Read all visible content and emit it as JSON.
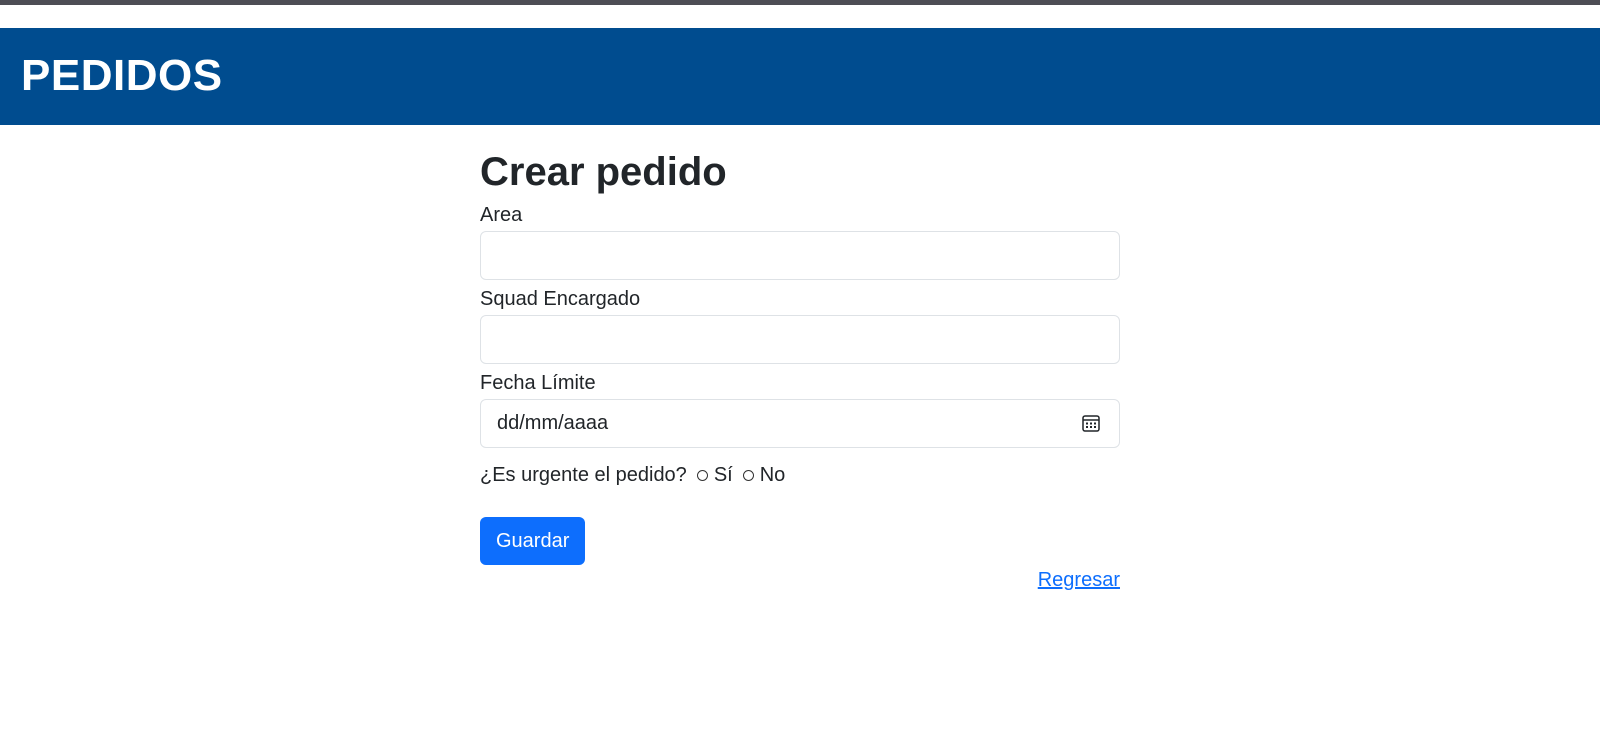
{
  "header": {
    "title": "PEDIDOS",
    "background_color": "#004c8f"
  },
  "form": {
    "title": "Crear pedido",
    "fields": {
      "area": {
        "label": "Area",
        "value": ""
      },
      "squad": {
        "label": "Squad Encargado",
        "value": ""
      },
      "deadline": {
        "label": "Fecha Límite",
        "value": "dd/mm/aaaa",
        "icon": "calendar-icon"
      }
    },
    "urgent": {
      "question": "¿Es urgente el pedido?",
      "options": [
        "Sí",
        "No"
      ]
    },
    "save_label": "Guardar",
    "back_label": "Regresar"
  },
  "colors": {
    "primary": "#0d6efd",
    "text": "#212529",
    "border": "#dee2e6"
  }
}
